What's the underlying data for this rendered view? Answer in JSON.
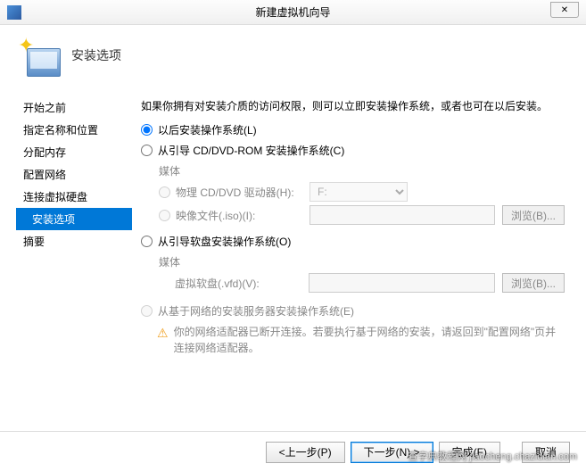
{
  "titlebar": {
    "title": "新建虚拟机向导",
    "close": "✕"
  },
  "header": {
    "title": "安装选项"
  },
  "sidebar": {
    "items": [
      {
        "label": "开始之前"
      },
      {
        "label": "指定名称和位置"
      },
      {
        "label": "分配内存"
      },
      {
        "label": "配置网络"
      },
      {
        "label": "连接虚拟硬盘"
      },
      {
        "label": "安装选项"
      },
      {
        "label": "摘要"
      }
    ]
  },
  "main": {
    "intro": "如果你拥有对安装介质的访问权限，则可以立即安装操作系统，或者也可在以后安装。",
    "opt_later": "以后安装操作系统(L)",
    "opt_cd": "从引导 CD/DVD-ROM 安装操作系统(C)",
    "media_label": "媒体",
    "phys_drive": "物理 CD/DVD 驱动器(H):",
    "drive_value": "F:",
    "iso_file": "映像文件(.iso)(I):",
    "browse": "浏览(B)...",
    "opt_floppy": "从引导软盘安装操作系统(O)",
    "vfd": "虚拟软盘(.vfd)(V):",
    "opt_net": "从基于网络的安装服务器安装操作系统(E)",
    "net_warning": "你的网络适配器已断开连接。若要执行基于网络的安装，请返回到\"配置网络\"页并连接网络适配器。"
  },
  "footer": {
    "prev": "<上一步(P)",
    "next": "下一步(N) >",
    "finish": "完成(F)",
    "cancel": "取消"
  },
  "watermark": "查字典教程网 jiaocheng.chazidian.com"
}
